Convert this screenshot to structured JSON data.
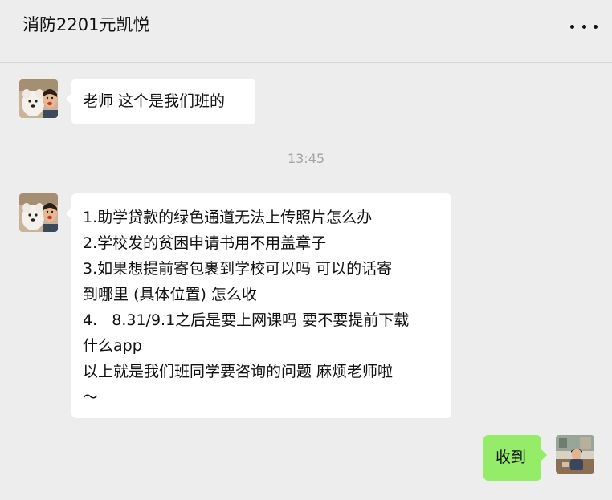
{
  "header": {
    "title": "消防2201元凯悦",
    "more_icon": "more-dots-icon"
  },
  "messages": [
    {
      "sender": "other",
      "avatar": "dog-and-person-avatar",
      "lines": [
        "老师 这个是我们班的"
      ]
    },
    {
      "type": "timestamp",
      "text": "13:45"
    },
    {
      "sender": "other",
      "avatar": "dog-and-person-avatar",
      "lines": [
        "1.助学贷款的绿色通道无法上传照片怎么办",
        "2.学校发的贫困申请书用不用盖章子",
        "3.如果想提前寄包裹到学校可以吗 可以的话寄",
        "到哪里 (具体位置) 怎么收",
        "4.   8.31/9.1之后是要上网课吗 要不要提前下载",
        "什么app",
        "以上就是我们班同学要咨询的问题 麻烦老师啦",
        "～"
      ]
    },
    {
      "sender": "me",
      "avatar": "my-photo-avatar",
      "lines": [
        "收到"
      ]
    }
  ],
  "colors": {
    "background": "#ededed",
    "bubble_other": "#ffffff",
    "bubble_mine": "#95ec69",
    "timestamp": "#a3a3a3"
  }
}
